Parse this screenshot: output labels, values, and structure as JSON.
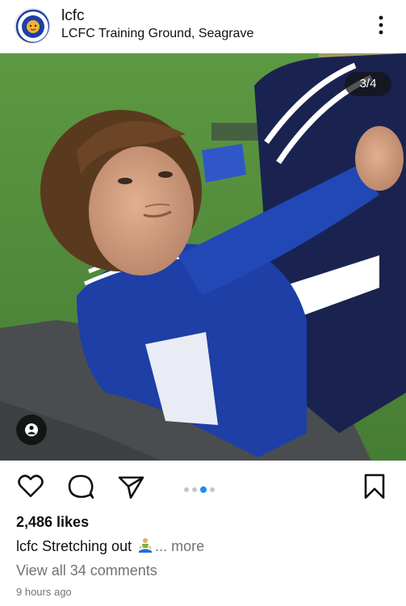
{
  "post": {
    "username": "lcfc",
    "location": "LCFC Training Ground, Seagrave",
    "menu_icon": "more-vertical-icon",
    "avatar_icon": "lcfc-crest-logo",
    "carousel_counter": "3/4",
    "carousel_total": 4,
    "carousel_current": 3,
    "user_tag_icon": "person-tag-icon"
  },
  "actions": {
    "like_icon": "heart-icon",
    "comment_icon": "comment-bubble-icon",
    "share_icon": "paper-plane-icon",
    "save_icon": "bookmark-icon"
  },
  "details": {
    "likes": "2,486 likes",
    "caption_user": "lcfc",
    "caption_text": "Stretching out",
    "caption_emoji": "🧘‍♂️",
    "caption_more": "... more",
    "view_comments": "View all 34 comments",
    "timestamp": "9 hours ago"
  },
  "colors": {
    "accent": "#1a8cff",
    "text": "#111111",
    "muted": "#737373",
    "kit_blue": "#1d3fa6",
    "grass": "#4f8a3b"
  }
}
